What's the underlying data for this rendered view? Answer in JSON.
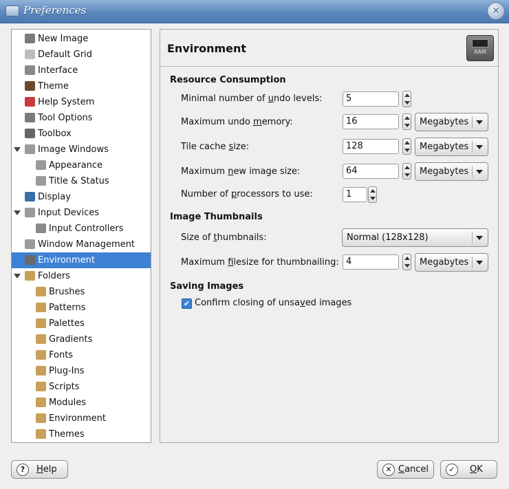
{
  "window": {
    "title": "Preferences"
  },
  "tree": {
    "items": [
      {
        "label": "New Image",
        "icon": "new-image-icon",
        "color": "#7a7a7a"
      },
      {
        "label": "Default Grid",
        "icon": "grid-icon",
        "color": "#bdbdbd"
      },
      {
        "label": "Interface",
        "icon": "interface-icon",
        "color": "#8a8a8a"
      },
      {
        "label": "Theme",
        "icon": "theme-icon",
        "color": "#6a4a2a"
      },
      {
        "label": "Help System",
        "icon": "help-system-icon",
        "color": "#c83c3c"
      },
      {
        "label": "Tool Options",
        "icon": "tool-options-icon",
        "color": "#7a7a7a"
      },
      {
        "label": "Toolbox",
        "icon": "toolbox-icon",
        "color": "#666666"
      },
      {
        "label": "Image Windows",
        "icon": "image-windows-icon",
        "color": "#9a9a9a",
        "expander": true
      },
      {
        "label": "Appearance",
        "icon": "appearance-icon",
        "color": "#9a9a9a",
        "child": true
      },
      {
        "label": "Title & Status",
        "icon": "title-status-icon",
        "color": "#9a9a9a",
        "child": true
      },
      {
        "label": "Display",
        "icon": "display-icon",
        "color": "#3a6ea8"
      },
      {
        "label": "Input Devices",
        "icon": "input-devices-icon",
        "color": "#9a9a9a",
        "expander": true
      },
      {
        "label": "Input Controllers",
        "icon": "input-controllers-icon",
        "color": "#8a8a8a",
        "child": true
      },
      {
        "label": "Window Management",
        "icon": "window-management-icon",
        "color": "#9a9a9a"
      },
      {
        "label": "Environment",
        "icon": "environment-icon",
        "color": "#6a6a6a",
        "selected": true
      },
      {
        "label": "Folders",
        "icon": "folder-icon",
        "color": "#c8a05a",
        "expander": true
      },
      {
        "label": "Brushes",
        "icon": "folder-icon",
        "color": "#c8a05a",
        "child": true
      },
      {
        "label": "Patterns",
        "icon": "folder-icon",
        "color": "#c8a05a",
        "child": true
      },
      {
        "label": "Palettes",
        "icon": "folder-icon",
        "color": "#c8a05a",
        "child": true
      },
      {
        "label": "Gradients",
        "icon": "folder-icon",
        "color": "#c8a05a",
        "child": true
      },
      {
        "label": "Fonts",
        "icon": "folder-icon",
        "color": "#c8a05a",
        "child": true
      },
      {
        "label": "Plug-Ins",
        "icon": "folder-icon",
        "color": "#c8a05a",
        "child": true
      },
      {
        "label": "Scripts",
        "icon": "folder-icon",
        "color": "#c8a05a",
        "child": true
      },
      {
        "label": "Modules",
        "icon": "folder-icon",
        "color": "#c8a05a",
        "child": true
      },
      {
        "label": "Environment",
        "icon": "folder-icon",
        "color": "#c8a05a",
        "child": true
      },
      {
        "label": "Themes",
        "icon": "folder-icon",
        "color": "#c8a05a",
        "child": true
      }
    ]
  },
  "panel": {
    "title": "Environment",
    "icon_text": "RAM",
    "resource": {
      "heading": "Resource Consumption",
      "undo_levels": {
        "pre": "Minimal number of ",
        "mn": "u",
        "post": "ndo levels:",
        "value": "5"
      },
      "undo_memory": {
        "pre": "Maximum undo ",
        "mn": "m",
        "post": "emory:",
        "value": "16",
        "unit": "Megabytes"
      },
      "tile_cache": {
        "pre": "Tile cache ",
        "mn": "s",
        "post": "ize:",
        "value": "128",
        "unit": "Megabytes"
      },
      "new_image": {
        "pre": "Maximum ",
        "mn": "n",
        "post": "ew image size:",
        "value": "64",
        "unit": "Megabytes"
      },
      "processors": {
        "pre": "Number of ",
        "mn": "p",
        "post": "rocessors to use:",
        "value": "1"
      }
    },
    "thumbnails": {
      "heading": "Image Thumbnails",
      "size": {
        "pre": "Size of ",
        "mn": "t",
        "post": "humbnails:",
        "value": "Normal (128x128)"
      },
      "filesize": {
        "pre": "Maximum ",
        "mn": "f",
        "post": "ilesize for thumbnailing:",
        "value": "4",
        "unit": "Megabytes"
      }
    },
    "saving": {
      "heading": "Saving Images",
      "confirm": {
        "pre": "Confirm closing of unsa",
        "mn": "v",
        "post": "ed images",
        "checked": true
      }
    }
  },
  "buttons": {
    "help": {
      "mn": "H",
      "rest": "elp"
    },
    "cancel": {
      "mn": "C",
      "rest": "ancel"
    },
    "ok": {
      "mn": "O",
      "rest": "K"
    }
  }
}
